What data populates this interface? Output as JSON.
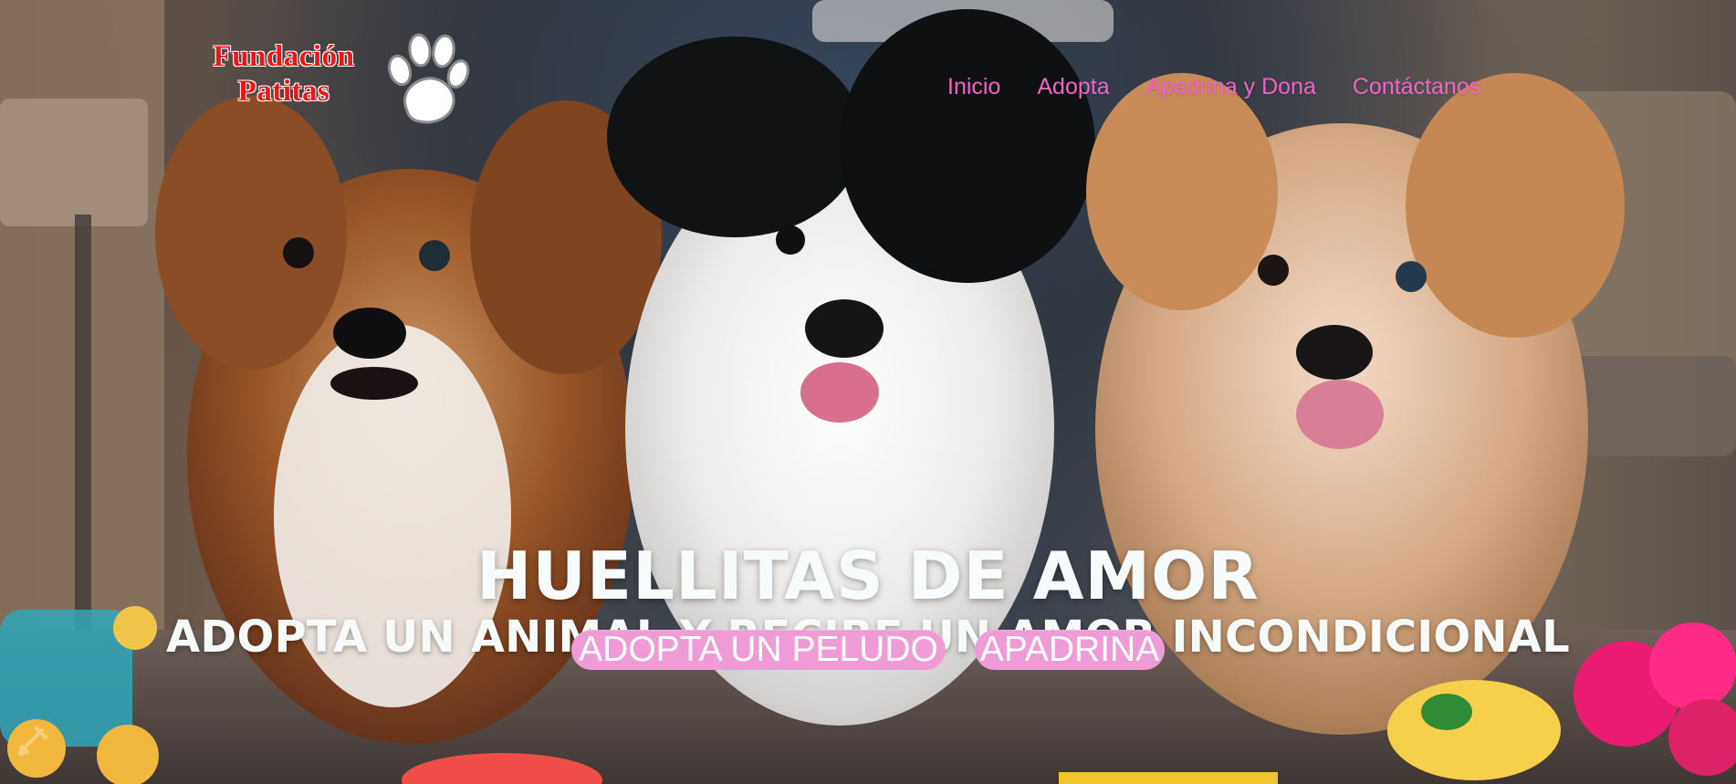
{
  "logo": {
    "line1": "Fundación",
    "line2": "Patitas",
    "icon": "paw-icon"
  },
  "nav": {
    "items": [
      "Inicio",
      "Adopta",
      "Apadrina y Dona",
      "Contáctanos"
    ]
  },
  "hero": {
    "title": "HUELLITAS DE AMOR",
    "subtitle": "ADOPTA UN ANIMAL Y RECIBE UN AMOR INCONDICIONAL"
  },
  "cta": {
    "adopt_label": "ADOPTA UN PELUDO",
    "sponsor_label": "APADRINA"
  },
  "colors": {
    "accent_pink": "#f063c9",
    "button_pink": "#ef9bd6",
    "logo_red": "#f11616",
    "hero_text": "#f8fbfb"
  },
  "icons": {
    "background": "puppies-photo-icon",
    "corner": "pencil-icon"
  }
}
